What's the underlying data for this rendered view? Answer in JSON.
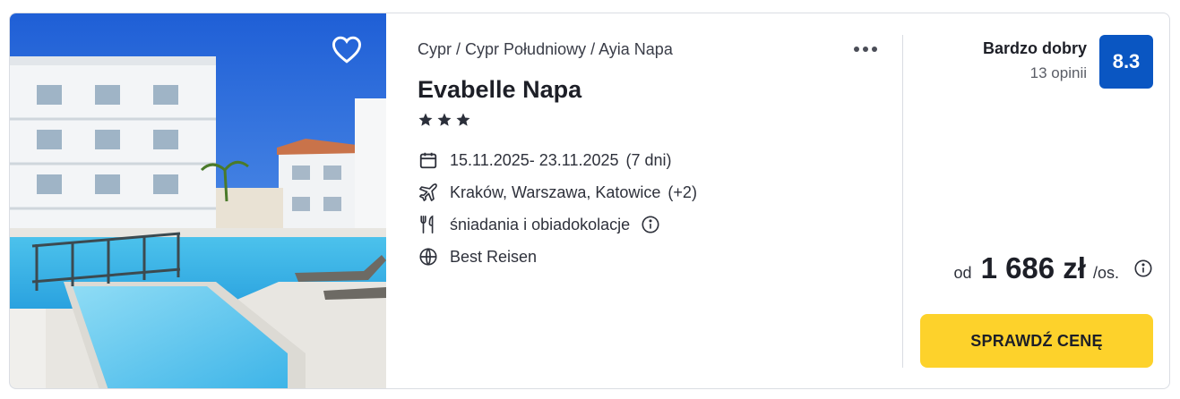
{
  "hotel": {
    "breadcrumb": [
      "Cypr",
      "Cypr Południowy",
      "Ayia Napa"
    ],
    "breadcrumb_separator": " / ",
    "name": "Evabelle Napa",
    "stars": 3,
    "dates": "15.11.2025- 23.11.2025",
    "duration": "(7 dni)",
    "departures": "Kraków, Warszawa, Katowice",
    "departures_more": "(+2)",
    "board": "śniadania i obiadokolacje",
    "operator": "Best Reisen"
  },
  "rating": {
    "label": "Bardzo dobry",
    "reviews": "13 opinii",
    "score": "8.3"
  },
  "price": {
    "prefix": "od",
    "amount": "1 686 zł",
    "suffix": "/os."
  },
  "cta": {
    "label": "SPRAWDŹ CENĘ"
  },
  "icons": {
    "favorite": "heart-outline-icon",
    "more": "more-horizontal-icon",
    "star": "star-icon",
    "calendar": "calendar-icon",
    "flight": "airplane-icon",
    "board": "cutlery-icon",
    "info": "info-circle-icon",
    "operator": "globe-icon"
  },
  "colors": {
    "score_bg": "#0a56c2",
    "cta_bg": "#fdd22b",
    "text": "#1d1f27"
  }
}
